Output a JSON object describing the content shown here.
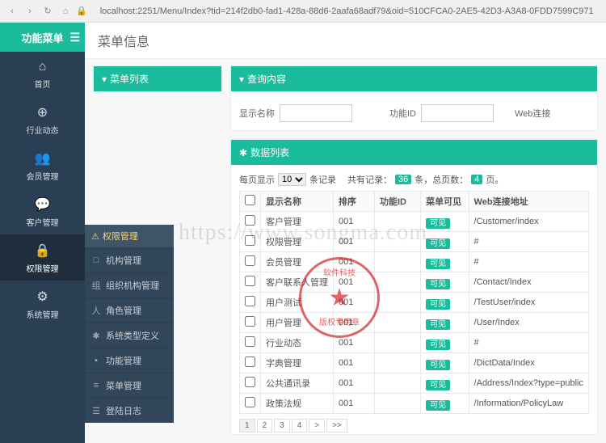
{
  "browser": {
    "url": "localhost:2251/Menu/Index?tid=214f2db0-fad1-428a-88d6-2aafa68adf79&oid=510CFCA0-2AE5-42D3-A3A8-0FDD7599C971"
  },
  "brand": "功能菜单",
  "page_title": "菜单信息",
  "sidebar": {
    "items": [
      {
        "icon": "⌂",
        "label": "首页"
      },
      {
        "icon": "⊕",
        "label": "行业动态"
      },
      {
        "icon": "👥",
        "label": "会员管理"
      },
      {
        "icon": "💬",
        "label": "客户管理"
      },
      {
        "icon": "🔒",
        "label": "权限管理"
      },
      {
        "icon": "⚙",
        "label": "系统管理"
      }
    ]
  },
  "submenu": {
    "header": "权限管理",
    "items": [
      {
        "icon": "□",
        "label": "机构管理"
      },
      {
        "icon": "组",
        "label": "组织机构管理"
      },
      {
        "icon": "人",
        "label": "角色管理"
      },
      {
        "icon": "✱",
        "label": "系统类型定义"
      },
      {
        "icon": "▪",
        "label": "功能管理"
      },
      {
        "icon": "≡",
        "label": "菜单管理"
      },
      {
        "icon": "☰",
        "label": "登陆日志"
      }
    ]
  },
  "left_panel": {
    "title": "菜单列表"
  },
  "search_panel": {
    "title": "查询内容",
    "fields": {
      "display_name_label": "显示名称",
      "function_id_label": "功能ID",
      "web_label": "Web连接"
    }
  },
  "data_panel": {
    "title": "数据列表",
    "pager_top": {
      "per_page_label_pre": "每页显示",
      "per_page_value": "10",
      "per_page_label_suf": "条记录",
      "total_label_pre": "共有记录：",
      "total_records": "36",
      "total_label_mid": "条，总页数：",
      "total_pages": "4",
      "total_label_suf": "页。"
    },
    "columns": {
      "display_name": "显示名称",
      "sort": "排序",
      "function_id": "功能ID",
      "visible": "菜单可见",
      "web_url": "Web连接地址"
    },
    "rows": [
      {
        "name": "客户管理",
        "sort": "001",
        "func": "",
        "vis": "可见",
        "url": "/Customer/index"
      },
      {
        "name": "权限管理",
        "sort": "001",
        "func": "",
        "vis": "可见",
        "url": "#"
      },
      {
        "name": "会员管理",
        "sort": "001",
        "func": "",
        "vis": "可见",
        "url": "#"
      },
      {
        "name": "客户联系人管理",
        "sort": "001",
        "func": "",
        "vis": "可见",
        "url": "/Contact/Index"
      },
      {
        "name": "用户测试",
        "sort": "001",
        "func": "",
        "vis": "可见",
        "url": "/TestUser/index"
      },
      {
        "name": "用户管理",
        "sort": "001",
        "func": "",
        "vis": "可见",
        "url": "/User/Index"
      },
      {
        "name": "行业动态",
        "sort": "001",
        "func": "",
        "vis": "可见",
        "url": "#"
      },
      {
        "name": "字典管理",
        "sort": "001",
        "func": "",
        "vis": "可见",
        "url": "/DictData/Index"
      },
      {
        "name": "公共通讯录",
        "sort": "001",
        "func": "",
        "vis": "可见",
        "url": "/Address/Index?type=public"
      },
      {
        "name": "政策法规",
        "sort": "001",
        "func": "",
        "vis": "可见",
        "url": "/Information/PolicyLaw"
      }
    ],
    "pagination": [
      "1",
      "2",
      "3",
      "4",
      ">",
      ">>"
    ]
  },
  "watermark": {
    "url_text": "https://www.songma.com",
    "stamp_top": "软件科技",
    "stamp_bottom": "版权专用章"
  }
}
